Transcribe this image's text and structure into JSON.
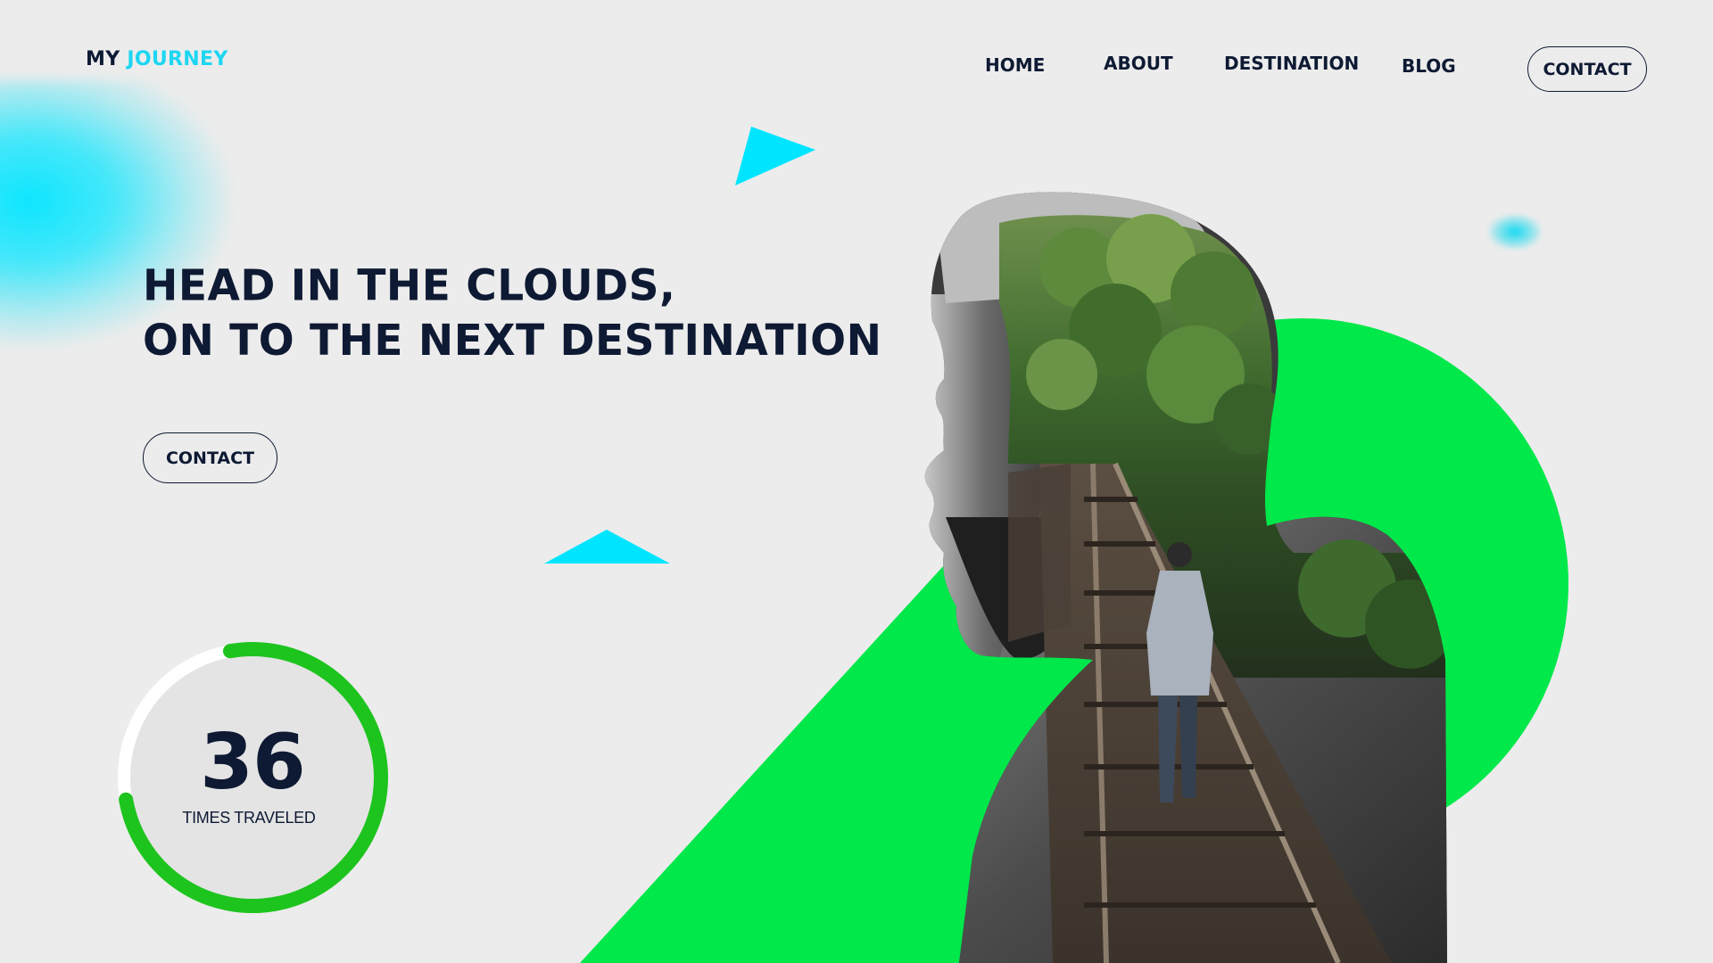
{
  "logo": {
    "part1": "MY",
    "part2": "JOURNEY"
  },
  "nav": {
    "home": "HOME",
    "about": "ABOUT",
    "destination": "DESTINATION",
    "blog": "BLOG",
    "contact": "CONTACT"
  },
  "hero": {
    "headline_line1": "HEAD IN THE CLOUDS,",
    "headline_line2": "ON TO THE NEXT DESTINATION",
    "contact_button": "CONTACT",
    "image_icon": "man-silhouette-forest-railway-image"
  },
  "stats": {
    "number": "36",
    "label": "TIMES TRAVELED",
    "progress": 0.75
  },
  "colors": {
    "navy": "#0e1a33",
    "cyan": "#00e5ff",
    "green": "#00e84a",
    "ring_green": "#1ec41e",
    "background": "#ececec"
  }
}
